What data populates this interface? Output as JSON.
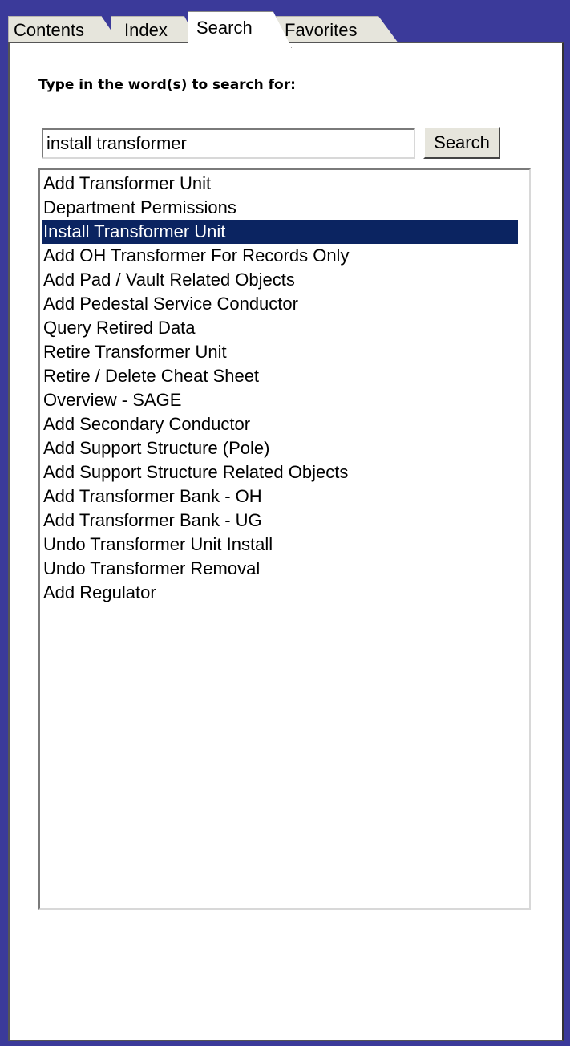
{
  "tabs": [
    {
      "label": "Contents",
      "active": false
    },
    {
      "label": "Index",
      "active": false
    },
    {
      "label": "Search",
      "active": true
    },
    {
      "label": "Favorites",
      "active": false
    }
  ],
  "search": {
    "prompt": "Type in the word(s) to search for:",
    "query": "install transformer",
    "button_label": "Search"
  },
  "results": {
    "selected_index": 2,
    "items": [
      "Add Transformer Unit",
      "Department Permissions",
      "Install Transformer Unit",
      "Add OH Transformer For Records Only",
      "Add Pad / Vault Related Objects",
      "Add Pedestal Service Conductor",
      "Query Retired Data",
      "Retire Transformer Unit",
      "Retire / Delete Cheat Sheet",
      "Overview - SAGE",
      "Add Secondary Conductor",
      "Add Support Structure (Pole)",
      "Add Support Structure Related Objects",
      "Add Transformer Bank - OH",
      "Add Transformer Bank - UG",
      "Undo Transformer Unit Install",
      "Undo Transformer Removal",
      "Add Regulator"
    ]
  },
  "colors": {
    "frame": "#3b3a9a",
    "selection": "#0b2461"
  }
}
